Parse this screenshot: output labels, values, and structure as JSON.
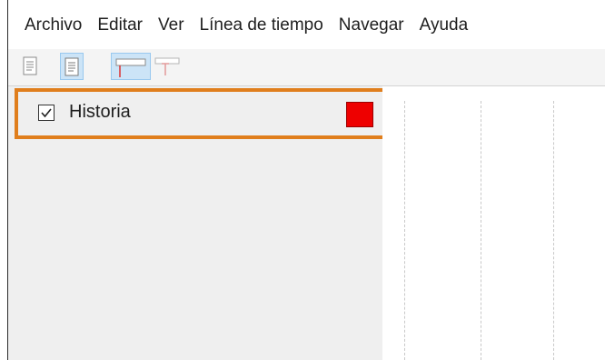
{
  "menubar": {
    "items": [
      "Archivo",
      "Editar",
      "Ver",
      "Línea de tiempo",
      "Navegar",
      "Ayuda"
    ]
  },
  "toolbar": {
    "buttons": [
      {
        "icon": "document-lines-icon",
        "active": false
      },
      {
        "icon": "document-lines-icon",
        "active": true
      },
      {
        "icon": "track-top-icon",
        "active": true
      },
      {
        "icon": "track-pin-icon",
        "active": false
      }
    ]
  },
  "layers": [
    {
      "name": "Historia",
      "checked": true,
      "color": "#ee0000"
    }
  ]
}
